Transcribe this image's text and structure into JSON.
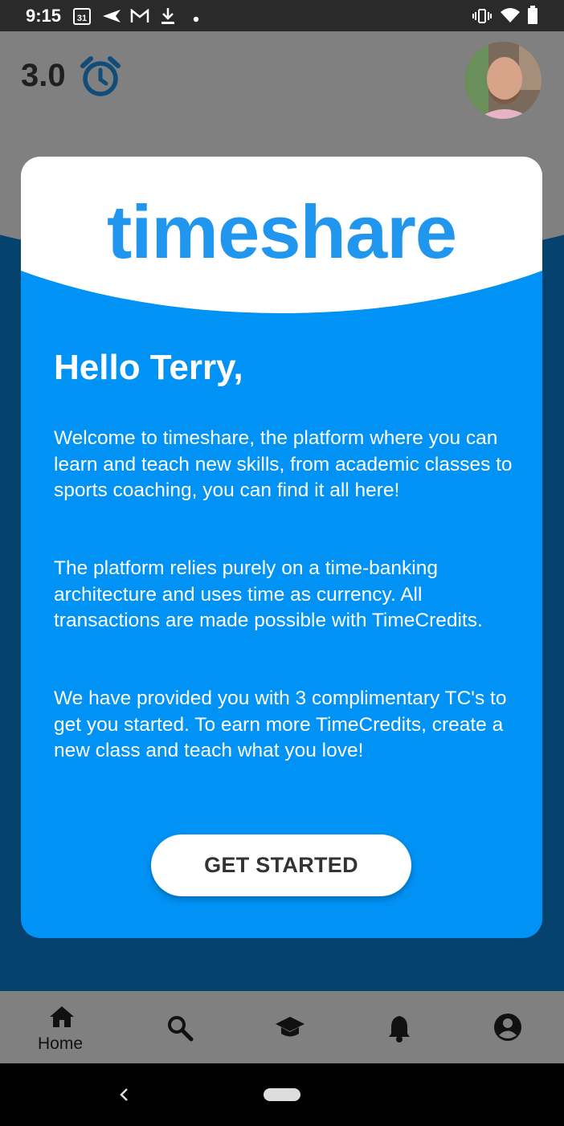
{
  "status_bar": {
    "time": "9:15",
    "calendar_day": "31",
    "left_icons": [
      "calendar-icon",
      "send-icon",
      "gmail-icon",
      "download-icon",
      "dot-icon"
    ],
    "right_icons": [
      "vibrate-icon",
      "wifi-icon",
      "battery-icon"
    ]
  },
  "header": {
    "credits": "3.0",
    "credits_icon": "alarm-clock-icon",
    "avatar": "user-avatar"
  },
  "modal": {
    "brand": "timeshare",
    "greeting": "Hello Terry,",
    "paragraphs": [
      "Welcome to timeshare, the platform where you can learn and teach new skills, from academic classes to sports coaching, you can find it all here!",
      "The platform relies purely on a time-banking architecture and uses time as currency. All transactions are made possible with TimeCredits.",
      "We have provided you with 3 complimentary TC's to get you started. To earn more TimeCredits, create a new class and teach what you love!"
    ],
    "cta_label": "GET STARTED"
  },
  "bottom_nav": {
    "items": [
      {
        "icon": "home-icon",
        "label": "Home",
        "active": true
      },
      {
        "icon": "search-icon"
      },
      {
        "icon": "graduation-cap-icon"
      },
      {
        "icon": "bell-icon"
      },
      {
        "icon": "account-circle-icon"
      }
    ]
  },
  "colors": {
    "modal_blue": "#0092f5",
    "brand_blue": "#2196ee",
    "dim_background": "#05426e",
    "dim_header": "#808080"
  }
}
